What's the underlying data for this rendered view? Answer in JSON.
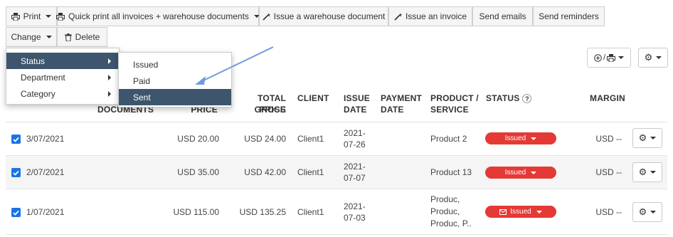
{
  "toolbar": {
    "print": "Print",
    "quick_print": "Quick print all invoices + warehouse documents",
    "issue_warehouse": "Issue a warehouse document",
    "issue_invoice": "Issue an invoice",
    "send_emails": "Send emails",
    "send_reminders": "Send reminders",
    "change": "Change",
    "delete": "Delete"
  },
  "change_menu": {
    "items": [
      {
        "label": "Status"
      },
      {
        "label": "Department"
      },
      {
        "label": "Category"
      }
    ]
  },
  "status_submenu": {
    "items": [
      {
        "label": "Issued"
      },
      {
        "label": "Paid"
      },
      {
        "label": "Sent"
      }
    ]
  },
  "print_options_button": {
    "label": "⊕ / "
  },
  "table": {
    "headers": {
      "documents": "DOCUMENTS",
      "price": "PRICE",
      "total_gross_1": "TOTAL GROSS",
      "total_gross_2": "PRICE",
      "client": "CLIENT",
      "issue_date_1": "ISSUE",
      "issue_date_2": "DATE",
      "payment_date_1": "PAYMENT",
      "payment_date_2": "DATE",
      "product_1": "PRODUCT /",
      "product_2": "SERVICE",
      "status": "STATUS",
      "status_help": "?",
      "margin": "MARGIN"
    },
    "rows": [
      {
        "date": "3/07/2021",
        "price": "USD 20.00",
        "gross": "USD 24.00",
        "client": "Client1",
        "issue_date_1": "2021-",
        "issue_date_2": "07-26",
        "product_1": "Product 2",
        "status": "Issued",
        "margin": "USD --"
      },
      {
        "date": "2/07/2021",
        "price": "USD 35.00",
        "gross": "USD 42.00",
        "client": "Client1",
        "issue_date_1": "2021-",
        "issue_date_2": "07-07",
        "product_1": "Product 13",
        "status": "Issued",
        "margin": "USD --"
      },
      {
        "date": "1/07/2021",
        "price": "USD 115.00",
        "gross": "USD 135.25",
        "client": "Client1",
        "issue_date_1": "2021-",
        "issue_date_2": "07-03",
        "product_1": "Produc,",
        "product_2": "Produc,",
        "product_3": "Produc, P..",
        "status": "Issued",
        "margin": "USD --"
      }
    ]
  },
  "colors": {
    "status_red": "#e53935",
    "menu_selected": "#3d566e",
    "checkbox": "#1a73e8",
    "annotation_arrow": "#6f9be0"
  }
}
